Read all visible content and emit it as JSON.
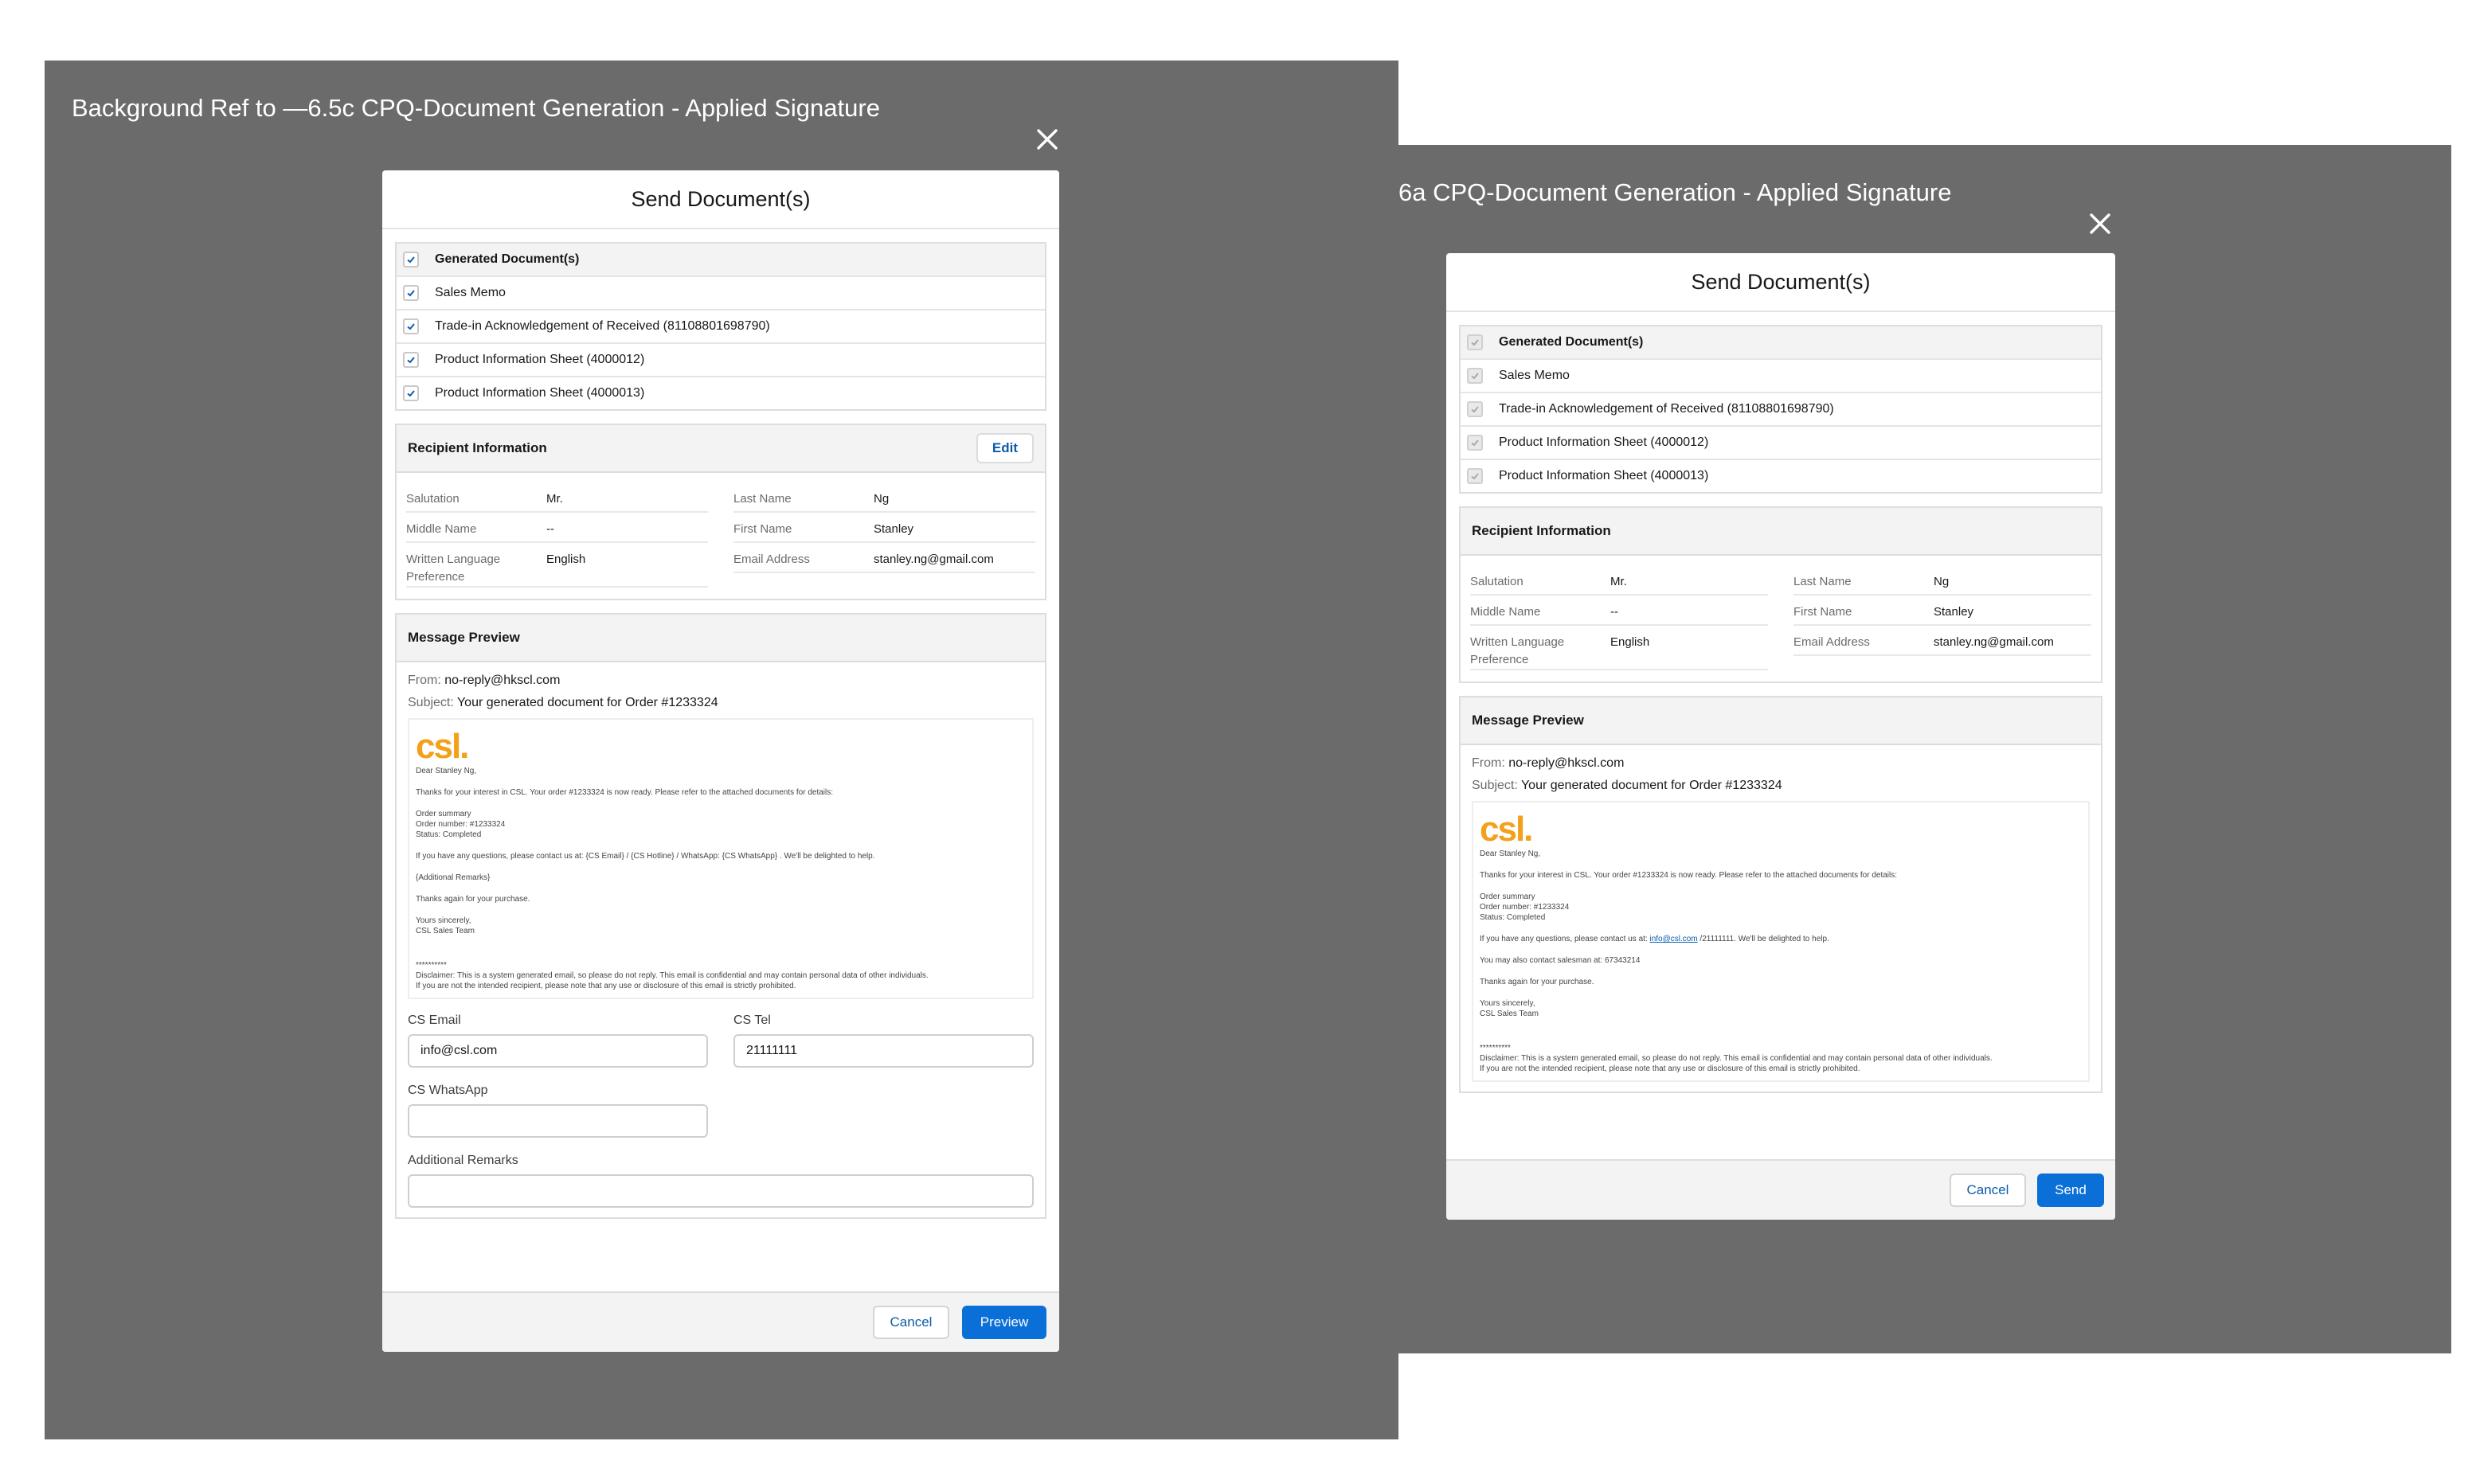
{
  "colors": {
    "frame_bg": "#6b6b6b",
    "brand_blue": "#0b6fd8",
    "link_blue": "#0b5cab",
    "csl_orange": "#f3a11a"
  },
  "left": {
    "frame_title": "Background Ref to —6.5c CPQ-Document Generation - Applied Signature",
    "modal_title": "Send Document(s)",
    "documents": [
      {
        "label": "Generated Document(s)",
        "checked": true
      },
      {
        "label": "Sales Memo",
        "checked": true
      },
      {
        "label": "Trade-in Acknowledgement of Received (81108801698790)",
        "checked": true
      },
      {
        "label": "Product Information Sheet (4000012)",
        "checked": true
      },
      {
        "label": "Product Information Sheet (4000013)",
        "checked": true
      }
    ],
    "recipient": {
      "title": "Recipient Information",
      "edit_label": "Edit",
      "salutation_label": "Salutation",
      "salutation": "Mr.",
      "middle_name_label": "Middle Name",
      "middle_name": "--",
      "language_label": "Written Language Preference",
      "language": "English",
      "last_name_label": "Last Name",
      "last_name": "Ng",
      "first_name_label": "First Name",
      "first_name": "Stanley",
      "email_label": "Email Address",
      "email": "stanley.ng@gmail.com"
    },
    "message": {
      "title": "Message Preview",
      "from_label": "From:",
      "from": "no-reply@hkscl.com",
      "subject_label": "Subject:",
      "subject": "Your generated document for Order #1233324",
      "logo": "csl.",
      "dear": "Dear Stanley Ng,",
      "thanks": "Thanks for your interest in CSL. Your order #1233324 is now ready. Please refer to the attached documents for details:",
      "summary1": "Order summary",
      "summary2": "Order number: #1233324",
      "summary3": "Status: Completed",
      "contact": "If you have any questions, please contact us at: {CS Email} / {CS Hotline} / WhatsApp: {CS WhatsApp} . We'll be delighted to help.",
      "remarks": "{Additional Remarks}",
      "thanks_again": "Thanks again for your purchase.",
      "yours": "Yours sincerely,",
      "team": "CSL Sales Team",
      "stars": "**********",
      "disclaimer1": "Disclaimer: This is a system generated email, so please do not reply. This email is confidential and may contain personal data of other individuals.",
      "disclaimer2": " If you are not the intended recipient, please note that any use or disclosure of this email is strictly prohibited."
    },
    "form": {
      "cs_email_label": "CS Email",
      "cs_email": "info@csl.com",
      "cs_tel_label": "CS Tel",
      "cs_tel": "21111111",
      "cs_whatsapp_label": "CS WhatsApp",
      "cs_whatsapp": "",
      "remarks_label": "Additional Remarks",
      "remarks": ""
    },
    "cancel_label": "Cancel",
    "preview_label": "Preview"
  },
  "right": {
    "frame_title": "6a CPQ-Document Generation - Applied Signature",
    "modal_title": "Send Document(s)",
    "documents": [
      {
        "label": "Generated Document(s)",
        "checked": true,
        "disabled": true
      },
      {
        "label": "Sales Memo",
        "checked": true,
        "disabled": true
      },
      {
        "label": "Trade-in Acknowledgement of Received (81108801698790)",
        "checked": true,
        "disabled": true
      },
      {
        "label": "Product Information Sheet (4000012)",
        "checked": true,
        "disabled": true
      },
      {
        "label": "Product Information Sheet (4000013)",
        "checked": true,
        "disabled": true
      }
    ],
    "recipient": {
      "title": "Recipient Information",
      "salutation_label": "Salutation",
      "salutation": "Mr.",
      "middle_name_label": "Middle Name",
      "middle_name": "--",
      "language_label": "Written Language Preference",
      "language": "English",
      "last_name_label": "Last Name",
      "last_name": "Ng",
      "first_name_label": "First Name",
      "first_name": "Stanley",
      "email_label": "Email Address",
      "email": "stanley.ng@gmail.com"
    },
    "message": {
      "title": "Message Preview",
      "from_label": "From:",
      "from": "no-reply@hkscl.com",
      "subject_label": "Subject:",
      "subject": "Your generated document for Order #1233324",
      "logo": "csl.",
      "dear": "Dear Stanley Ng,",
      "thanks": "Thanks for your interest in CSL. Your order #1233324 is now ready. Please refer to the attached documents for details:",
      "summary1": "Order summary",
      "summary2": "Order number: #1233324",
      "summary3": "Status: Completed",
      "contact_pre": "If you have any questions, please contact us at: ",
      "contact_link": "info@csl.com",
      "contact_post": " /21111111. We'll be delighted to help.",
      "salesman": "You may also contact salesman at: 67343214",
      "thanks_again": "Thanks again for your purchase.",
      "yours": "Yours sincerely,",
      "team": "CSL Sales Team",
      "stars": "**********",
      "disclaimer1": "Disclaimer: This is a system generated email, so please do not reply. This email is confidential and may contain personal data of other individuals.",
      "disclaimer2": " If you are not the intended recipient, please note that any use or disclosure of this email is strictly prohibited."
    },
    "cancel_label": "Cancel",
    "send_label": "Send"
  }
}
